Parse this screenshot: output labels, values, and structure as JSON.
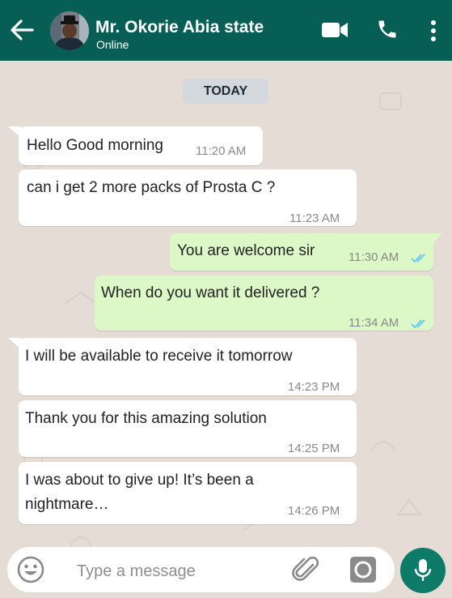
{
  "header": {
    "contact_name": "Mr. Okorie Abia state",
    "status": "Online",
    "colors": {
      "bar": "#075e54",
      "text": "#ffffff"
    }
  },
  "date_chip": "TODAY",
  "messages": [
    {
      "direction": "incoming",
      "text": "Hello Good morning",
      "time": "11:20 AM"
    },
    {
      "direction": "incoming",
      "text": "can i get 2 more packs of Prosta C ?",
      "time": "11:23 AM"
    },
    {
      "direction": "outgoing",
      "text": "You are welcome sir",
      "time": "11:30 AM",
      "status": "read"
    },
    {
      "direction": "outgoing",
      "text": "When do you want it delivered ?",
      "time": "11:34 AM",
      "status": "read"
    },
    {
      "direction": "incoming",
      "text": "I will be available to receive it tomorrow",
      "time": "14:23 PM"
    },
    {
      "direction": "incoming",
      "text": "Thank you for this amazing solution",
      "time": "14:25 PM"
    },
    {
      "direction": "incoming",
      "text_line1": "I was about to give up! It’s been a",
      "text_line2": "nightmare…",
      "time": "14:26 PM"
    }
  ],
  "composer": {
    "placeholder": "Type a message",
    "icons": [
      "emoji-icon",
      "attach-icon",
      "camera-icon",
      "mic-icon"
    ]
  },
  "colors": {
    "background": "#e5ddd5",
    "incoming_bubble": "#ffffff",
    "outgoing_bubble": "#dcf8c6",
    "read_ticks": "#4fc3f7",
    "mic_button": "#0d7b68"
  }
}
